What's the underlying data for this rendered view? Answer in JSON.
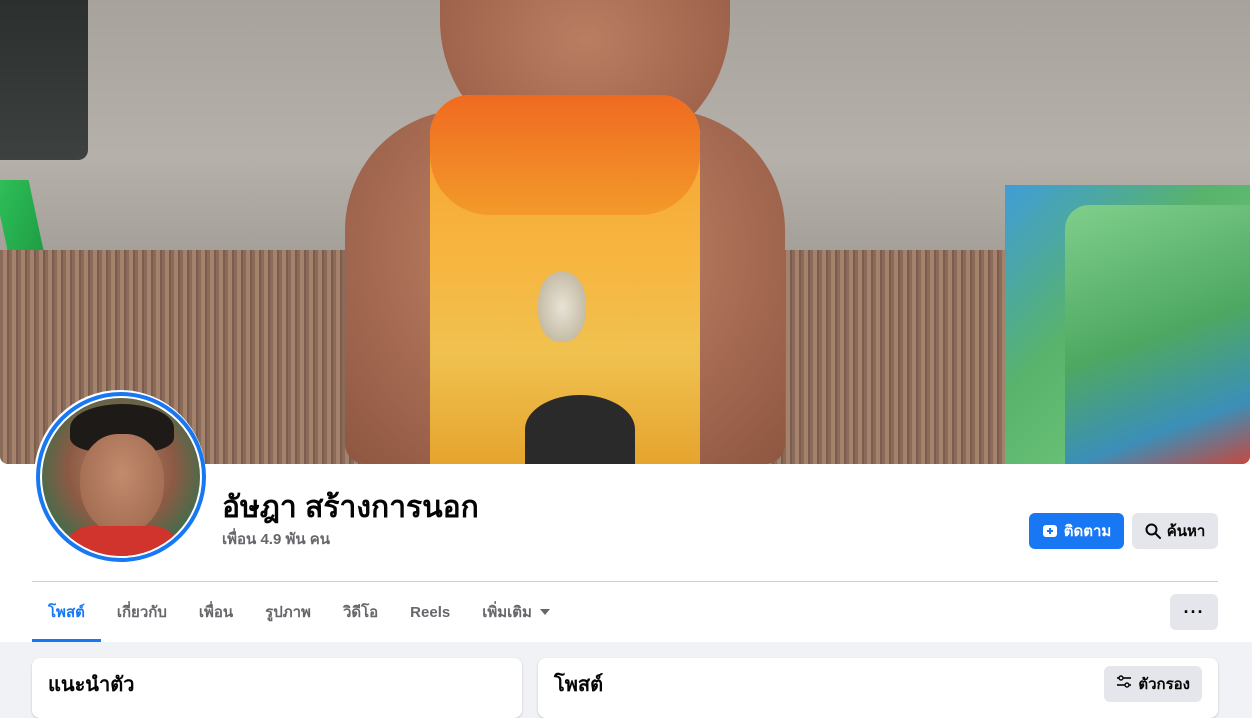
{
  "profile": {
    "name": "อัษฎา สร้างการนอก",
    "friends": "เพื่อน 4.9 พัน คน"
  },
  "actions": {
    "follow_label": "ติดตาม",
    "search_label": "ค้นหา",
    "more_label": "···"
  },
  "tabs": [
    {
      "label": "โพสต์",
      "active": true
    },
    {
      "label": "เกี่ยวกับ"
    },
    {
      "label": "เพื่อน"
    },
    {
      "label": "รูปภาพ"
    },
    {
      "label": "วิดีโอ"
    },
    {
      "label": "Reels"
    },
    {
      "label": "เพิ่มเติม"
    }
  ],
  "intro": {
    "title": "แนะนำตัว"
  },
  "posts": {
    "title": "โพสต์",
    "filter_label": "ตัวกรอง"
  },
  "colors": {
    "accent": "#1877f2",
    "page_bg": "#f0f2f5",
    "button_gray": "#e4e6eb",
    "muted_text": "#65676b"
  }
}
